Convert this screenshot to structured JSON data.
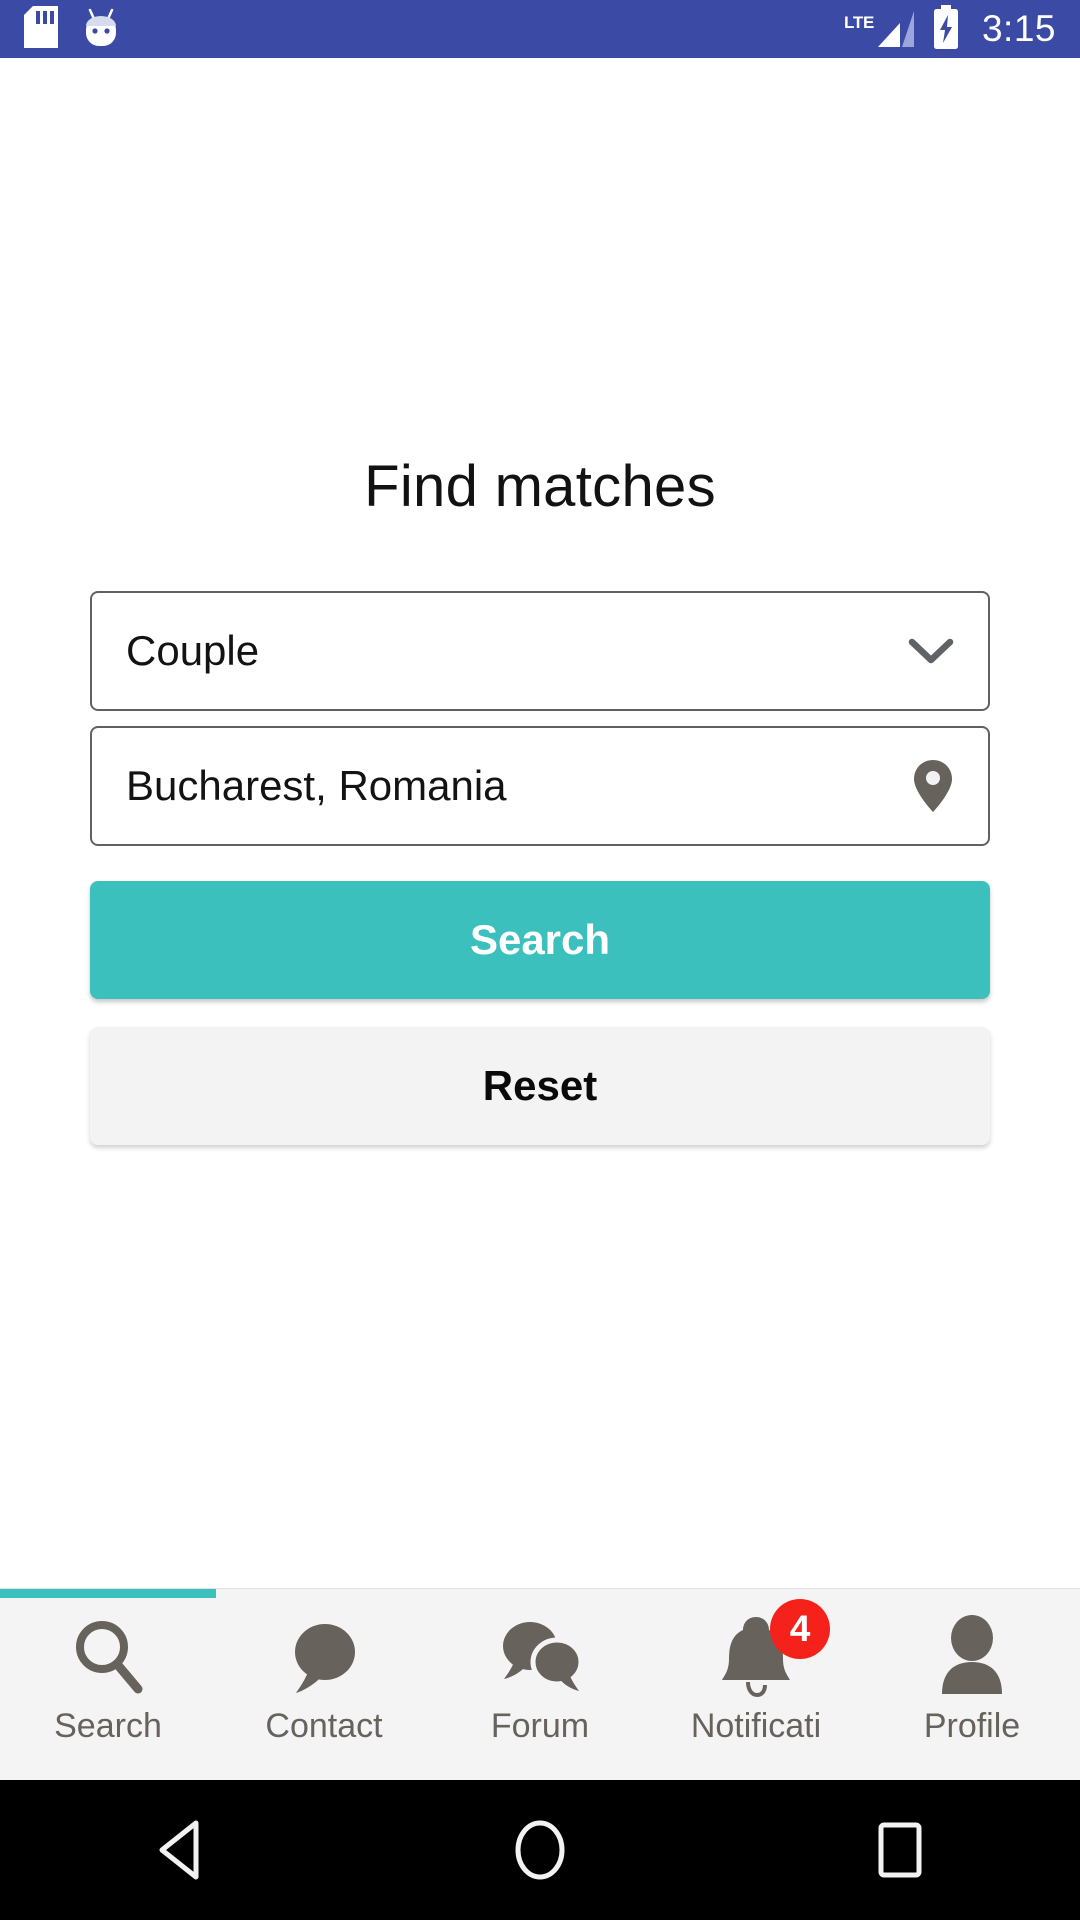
{
  "statusbar": {
    "time": "3:15",
    "network_type": "LTE",
    "icons": [
      "sd-card-icon",
      "android-marshmallow-icon",
      "lte-signal-icon",
      "battery-charging-icon"
    ],
    "background_color": "#3b4ba5"
  },
  "main": {
    "title": "Find matches",
    "fields": [
      {
        "name": "relationship-type",
        "value": "Couple",
        "icon": "chevron-down-icon"
      },
      {
        "name": "location",
        "value": "Bucharest, Romania",
        "icon": "location-pin-icon"
      }
    ],
    "buttons": {
      "search_label": "Search",
      "reset_label": "Reset",
      "search_color": "#3cc0bd",
      "reset_color": "#f3f3f3"
    }
  },
  "tabbar": {
    "active_index": 0,
    "indicator_color": "#3cc0bd",
    "items": [
      {
        "label": "Search",
        "icon": "search-icon",
        "badge": ""
      },
      {
        "label": "Contact",
        "icon": "chat-bubble-icon",
        "badge": ""
      },
      {
        "label": "Forum",
        "icon": "forum-bubbles-icon",
        "badge": ""
      },
      {
        "label": "Notificati",
        "icon": "bell-icon",
        "badge": "4"
      },
      {
        "label": "Profile",
        "icon": "person-icon",
        "badge": ""
      }
    ],
    "badge_color": "#f5221b"
  },
  "sysnav": {
    "buttons": [
      {
        "name": "back-button",
        "icon": "triangle-left-icon"
      },
      {
        "name": "home-button",
        "icon": "circle-icon"
      },
      {
        "name": "recents-button",
        "icon": "square-icon"
      }
    ]
  }
}
